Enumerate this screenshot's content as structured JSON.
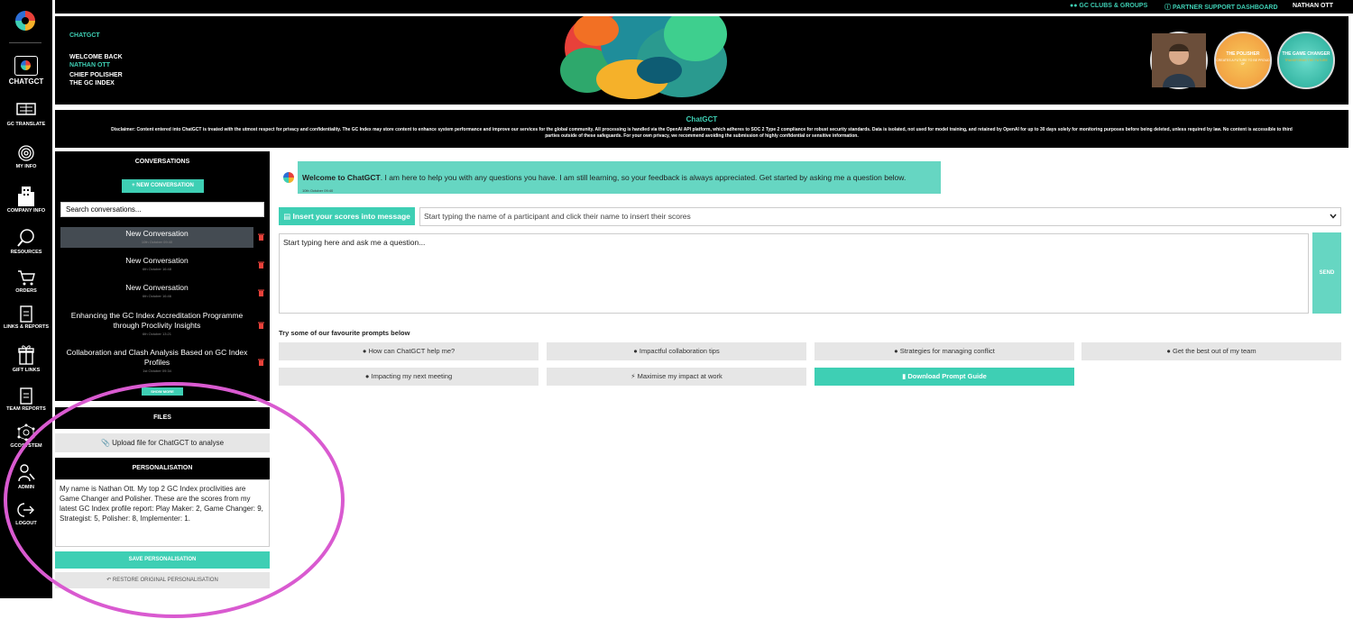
{
  "topbar": {
    "clubs": "GC CLUBS & GROUPS",
    "partner": "PARTNER SUPPORT DASHBOARD",
    "user": "NATHAN OTT"
  },
  "header": {
    "app": "CHATGCT",
    "welcome": "WELCOME BACK",
    "name": "NATHAN OTT",
    "role1": "CHIEF POLISHER",
    "role2": "THE GC INDEX",
    "badges": [
      {
        "title": "THE POLISHER",
        "sub": "CREATES A FUTURE TO BE PROUD OF"
      },
      {
        "title": "THE GAME CHANGER",
        "sub": "TRANSFORMS THE FUTURE"
      }
    ]
  },
  "nav": {
    "items": [
      {
        "label": "CHATGCT"
      },
      {
        "label": "GC TRANSLATE"
      },
      {
        "label": "MY INFO"
      },
      {
        "label": "COMPANY INFO"
      },
      {
        "label": "RESOURCES"
      },
      {
        "label": "ORDERS"
      },
      {
        "label": "LINKS & REPORTS"
      },
      {
        "label": "GIFT LINKS"
      },
      {
        "label": "TEAM REPORTS"
      },
      {
        "label": "GCOSYSTEM"
      },
      {
        "label": "ADMIN"
      },
      {
        "label": "LOGOUT"
      }
    ]
  },
  "disclaimer": {
    "title": "ChatGCT",
    "text": "Disclaimer: Content entered into ChatGCT is treated with the utmost respect for privacy and confidentiality. The GC Index may store content to enhance system performance and improve our services for the global community. All processing is handled via the OpenAI API platform, which adheres to SOC 2 Type 2 compliance for robust security standards. Data is isolated, not used for model training, and retained by OpenAI for up to 30 days solely for monitoring purposes before being deleted, unless required by law. No content is accessible to third parties outside of these safeguards. For your own privacy, we recommend avoiding the submission of highly confidential or sensitive information."
  },
  "conversations": {
    "title": "CONVERSATIONS",
    "new_label": "+ NEW CONVERSATION",
    "search_placeholder": "Search conversations...",
    "items": [
      {
        "title": "New Conversation",
        "date": "10th October 09:40"
      },
      {
        "title": "New Conversation",
        "date": "6th October 16:48"
      },
      {
        "title": "New Conversation",
        "date": "6th October 16:46"
      },
      {
        "title": "Enhancing the GC Index Accreditation Programme through Proclivity Insights",
        "date": "6th October 13:21"
      },
      {
        "title": "Collaboration and Clash Analysis Based on GC Index Profiles",
        "date": "1st October 09:34"
      }
    ],
    "show_more": "SHOW MORE"
  },
  "files": {
    "title": "FILES",
    "upload_label": "Upload file for ChatGCT to analyse"
  },
  "personalisation": {
    "title": "PERSONALISATION",
    "text": "My name is Nathan Ott. My top 2 GC Index proclivities are Game Changer and Polisher. These are the scores from my latest GC Index profile report: Play Maker: 2, Game Changer: 9, Strategist: 5, Polisher: 8, Implementer: 1.",
    "save_label": "SAVE PERSONALISATION",
    "restore_label": "RESTORE ORIGINAL PERSONALISATION"
  },
  "chat": {
    "welcome_bold": "Welcome to ChatGCT",
    "welcome_rest": ". I am here to help you with any questions you have. I am still learning, so your feedback is always appreciated. Get started by asking me a question below.",
    "welcome_date": "10th October 09:40",
    "insert_label": "Insert your scores into message",
    "participant_placeholder": "Start typing the name of a participant and click their name to insert their scores",
    "question_placeholder": "Start typing here and ask me a question...",
    "send_label": "SEND",
    "prompts_title": "Try some of our favourite prompts below",
    "prompts": [
      {
        "label": "How can ChatGCT help me?",
        "icon": "lightbulb-icon"
      },
      {
        "label": "Impactful collaboration tips",
        "icon": "handshake-icon"
      },
      {
        "label": "Strategies for managing conflict",
        "icon": "users-cog-icon"
      },
      {
        "label": "Get the best out of my team",
        "icon": "team-icon"
      },
      {
        "label": "Impacting my next meeting",
        "icon": "chat-icon"
      },
      {
        "label": "Maximise my impact at work",
        "icon": "bolt-icon"
      },
      {
        "label": "Download Prompt Guide",
        "icon": "document-icon"
      }
    ]
  },
  "colors": {
    "accent": "#3ecfb4",
    "highlight": "#d95ad0",
    "nav_bg": "#000000"
  }
}
